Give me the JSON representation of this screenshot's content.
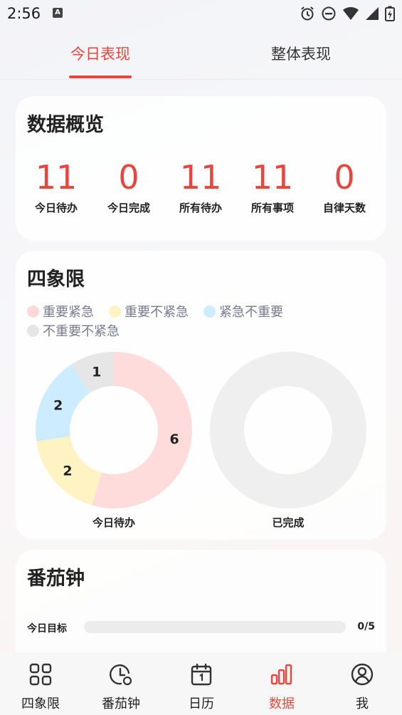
{
  "status_bar": {
    "time": "2:56"
  },
  "tabs": [
    {
      "label": "今日表现",
      "active": true
    },
    {
      "label": "整体表现",
      "active": false
    }
  ],
  "overview": {
    "title": "数据概览",
    "stats": [
      {
        "value": "11",
        "label": "今日待办"
      },
      {
        "value": "0",
        "label": "今日完成"
      },
      {
        "value": "11",
        "label": "所有待办"
      },
      {
        "value": "11",
        "label": "所有事项"
      },
      {
        "value": "0",
        "label": "自律天数"
      }
    ]
  },
  "quadrant": {
    "title": "四象限",
    "legend": [
      {
        "label": "重要紧急",
        "color": "#ffd9d9"
      },
      {
        "label": "重要不紧急",
        "color": "#fff3c4"
      },
      {
        "label": "紧急不重要",
        "color": "#cdecff"
      },
      {
        "label": "不重要不紧急",
        "color": "#e6e6e6"
      }
    ]
  },
  "chart_data": [
    {
      "type": "pie",
      "xlabel": "今日待办",
      "categories": [
        "重要紧急",
        "重要不紧急",
        "紧急不重要",
        "不重要不紧急"
      ],
      "values": [
        6,
        2,
        2,
        1
      ],
      "colors": [
        "#ffdcdc",
        "#fff3c4",
        "#cdecff",
        "#e6e6e6"
      ]
    },
    {
      "type": "pie",
      "xlabel": "已完成",
      "categories": [
        "重要紧急",
        "重要不紧急",
        "紧急不重要",
        "不重要不紧急"
      ],
      "values": [
        0,
        0,
        0,
        0
      ],
      "colors": [
        "#ffdcdc",
        "#fff3c4",
        "#cdecff",
        "#e6e6e6"
      ],
      "empty_color": "#efefef"
    }
  ],
  "pomodoro": {
    "title": "番茄钟",
    "goal_label": "今日目标",
    "goal_value": "0/5",
    "goal_progress": 0
  },
  "bottom_nav": [
    {
      "label": "四象限",
      "icon": "grid-icon",
      "active": false
    },
    {
      "label": "番茄钟",
      "icon": "clock-icon",
      "active": false
    },
    {
      "label": "日历",
      "icon": "calendar-icon",
      "active": false
    },
    {
      "label": "数据",
      "icon": "bar-chart-icon",
      "active": true
    },
    {
      "label": "我",
      "icon": "user-icon",
      "active": false
    }
  ],
  "colors": {
    "accent": "#e8453c"
  }
}
